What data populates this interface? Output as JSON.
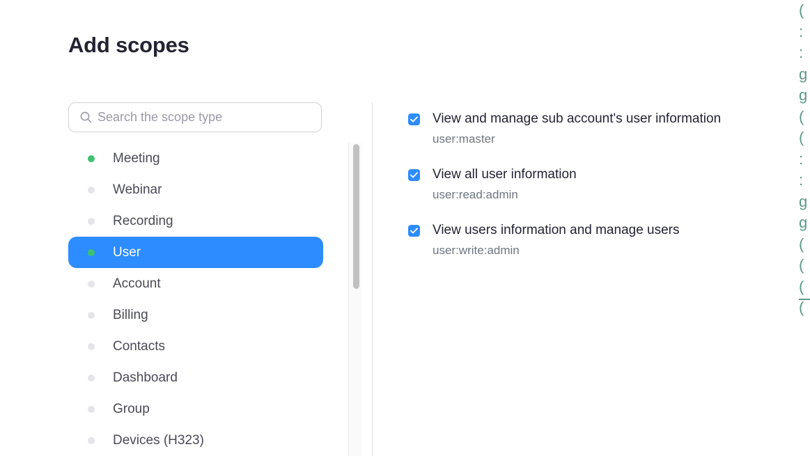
{
  "title": "Add scopes",
  "search": {
    "placeholder": "Search the scope type",
    "icon": "search-icon"
  },
  "scope_types": [
    {
      "label": "Meeting",
      "status": "active"
    },
    {
      "label": "Webinar",
      "status": "inactive"
    },
    {
      "label": "Recording",
      "status": "inactive"
    },
    {
      "label": "User",
      "status": "active",
      "selected": true
    },
    {
      "label": "Account",
      "status": "inactive"
    },
    {
      "label": "Billing",
      "status": "inactive"
    },
    {
      "label": "Contacts",
      "status": "inactive"
    },
    {
      "label": "Dashboard",
      "status": "inactive"
    },
    {
      "label": "Group",
      "status": "inactive"
    },
    {
      "label": "Devices (H323)",
      "status": "inactive"
    }
  ],
  "scopes": [
    {
      "title": "View and manage sub account's user information",
      "code": "user:master",
      "checked": true
    },
    {
      "title": "View all user information",
      "code": "user:read:admin",
      "checked": true
    },
    {
      "title": "View users information and manage users",
      "code": "user:write:admin",
      "checked": true
    }
  ],
  "edge_glyphs": [
    "(",
    ":",
    ":",
    "g",
    "g",
    "(",
    "(",
    ":",
    ":",
    "g",
    "g",
    "(",
    "(",
    "(",
    "("
  ],
  "colors": {
    "accent": "#2d8cff",
    "active_dot": "#3dc270",
    "inactive_dot": "#e4e4ea",
    "edge": "#5b9a8a"
  }
}
